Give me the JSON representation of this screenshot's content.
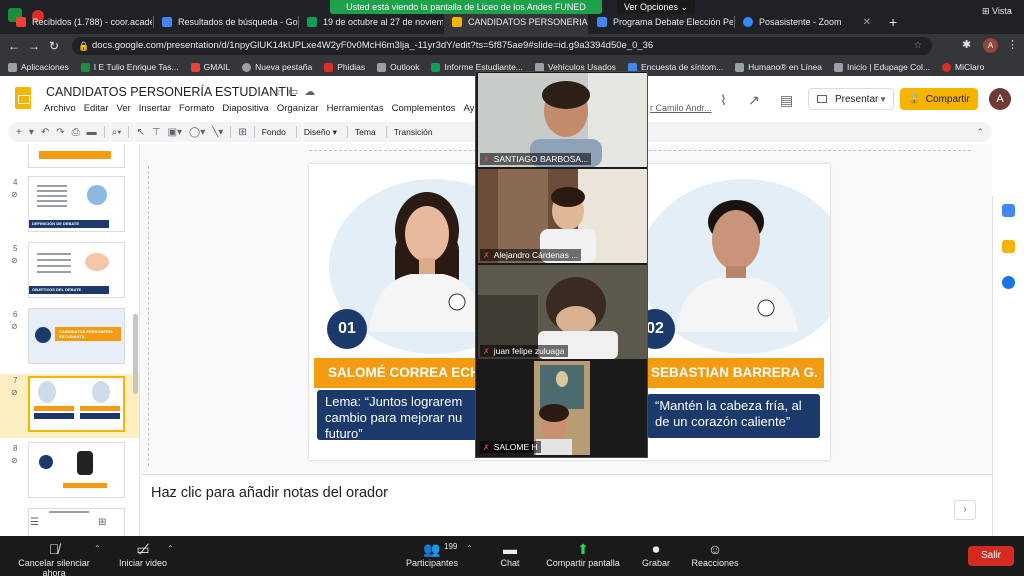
{
  "browser": {
    "tabs": [
      {
        "label": "Recibidos (1.788) - coor.acade",
        "color": "#ea4335",
        "active": false
      },
      {
        "label": "Resultados de búsqueda - Goo",
        "color": "#4285f4",
        "active": false
      },
      {
        "label": "19 de octubre al 27 de noviem",
        "color": "#0f9d58",
        "active": false
      },
      {
        "label": "CANDIDATOS PERSONERIA ES",
        "color": "#f4b400",
        "active": true
      },
      {
        "label": "Programa Debate Elección Pers",
        "color": "#4285f4",
        "active": false
      },
      {
        "label": "Posasistente - Zoom",
        "color": "#2d8cff",
        "active": false
      }
    ],
    "vista_label": "Vista",
    "url": "docs.google.com/presentation/d/1npyGlUK14kUPLxe4W2yF0v0McH6m3lja_-11yr3dY/edit?ts=5f875ae9#slide=id.g9a3394d50e_0_36",
    "profile_initial": "A",
    "bookmarks": [
      {
        "label": "Aplicaciones",
        "color": "#9aa0a6"
      },
      {
        "label": "I E Tulio Enrique Tas...",
        "color": "#1e8e3e"
      },
      {
        "label": "GMAIL",
        "color": "#ea4335"
      },
      {
        "label": "Nueva pestaña",
        "color": "#9aa0a6"
      },
      {
        "label": "Phidias",
        "color": "#d93025"
      },
      {
        "label": "Outlook",
        "color": "#9aa0a6"
      },
      {
        "label": "Informe Estudiante...",
        "color": "#0f9d58"
      },
      {
        "label": "Vehículos Usados",
        "color": "#9aa0a6"
      },
      {
        "label": "Encuesta de síntom...",
        "color": "#4285f4"
      },
      {
        "label": "Humano® en Línea",
        "color": "#9aa0a6"
      },
      {
        "label": "Inicio | Edupage Col...",
        "color": "#9aa0a6"
      },
      {
        "label": "MiClaro",
        "color": "#d93025"
      }
    ]
  },
  "zoom_banner": {
    "sharing_text": "Usted está viendo la pantalla de Liceo de los Andes FUNED",
    "options_label": "Ver Opciones"
  },
  "docs": {
    "title": "CANDIDATOS PERSONERÍA ESTUDIANTIL",
    "menu": [
      "Archivo",
      "Editar",
      "Ver",
      "Insertar",
      "Formato",
      "Diapositiva",
      "Organizar",
      "Herramientas",
      "Complementos",
      "Ay"
    ],
    "last_edit": "r Camilo Andr...",
    "present_label": "Presentar",
    "share_label": "Compartir",
    "avatar_initial": "A",
    "toolbar_text": [
      "Fondo",
      "Diseño",
      "Tema",
      "Transición"
    ],
    "speaker_notes_placeholder": "Haz clic para añadir notas del orador"
  },
  "filmstrip": {
    "slides": [
      {
        "num": "4",
        "caption": "DEFINICIÓN DE DEBATE"
      },
      {
        "num": "5",
        "caption": "OBJETIVOS DEL DEBATE"
      },
      {
        "num": "6",
        "caption": "CANDIDATOS PERSONERÍA ESTUDIANTIL"
      },
      {
        "num": "7",
        "caption": "",
        "selected": true
      },
      {
        "num": "8",
        "caption": ""
      }
    ]
  },
  "slide": {
    "candidate1": {
      "number": "01",
      "name": "SALOMÉ CORREA ECH",
      "slogan": "Lema: “Juntos lograrem cambio para mejorar nu futuro”"
    },
    "candidate2": {
      "number": "02",
      "name": "SEBASTIAN BARRERA G.",
      "slogan": "“Mantén la cabeza fría, al de un corazón caliente”"
    }
  },
  "zoom": {
    "participants": [
      {
        "name": "SANTIAGO BARBOSA..."
      },
      {
        "name": "Alejandro Cárdenas ..."
      },
      {
        "name": "juan felipe zuluaga"
      },
      {
        "name": "SALOME H"
      }
    ],
    "controls": {
      "mute_label": "Cancelar silenciar ahora",
      "video_label": "Iniciar video",
      "participants_label": "Participantes",
      "participants_count": "199",
      "chat_label": "Chat",
      "share_label": "Compartir pantalla",
      "record_label": "Grabar",
      "reactions_label": "Reacciones",
      "leave_label": "Salir"
    }
  }
}
